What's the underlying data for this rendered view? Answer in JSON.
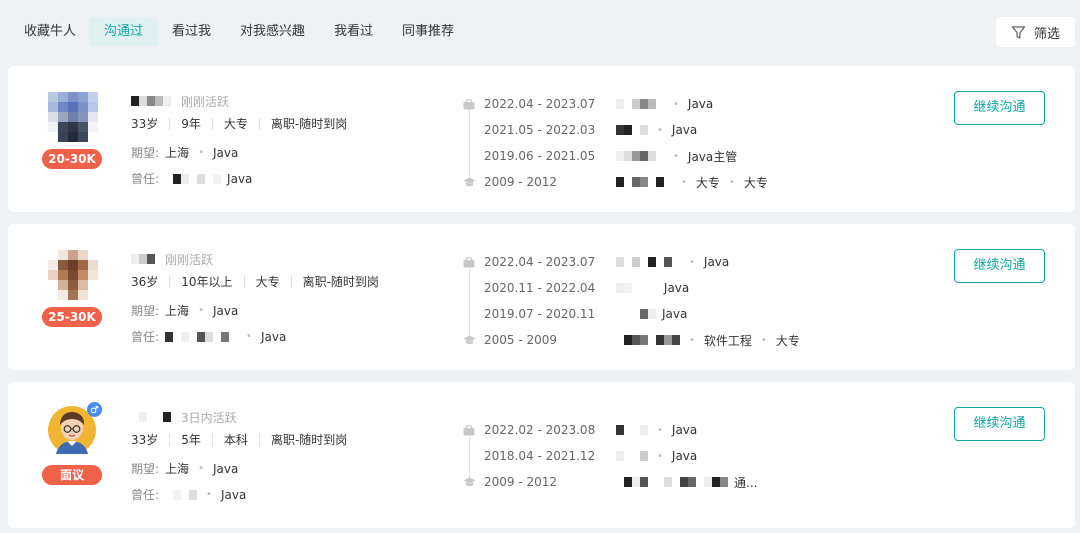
{
  "tabs": [
    {
      "label": "收藏牛人",
      "active": false
    },
    {
      "label": "沟通过",
      "active": true
    },
    {
      "label": "看过我",
      "active": false
    },
    {
      "label": "对我感兴趣",
      "active": false
    },
    {
      "label": "我看过",
      "active": false
    },
    {
      "label": "同事推荐",
      "active": false
    }
  ],
  "filter": {
    "label": "筛选",
    "icon": "filter-icon"
  },
  "colors": {
    "accent": "#12a4a6",
    "badge": "#f0614a",
    "background": "#eef2f5"
  },
  "candidates": [
    {
      "status": "刚刚活跃",
      "age": "33岁",
      "experience": "9年",
      "education": "大专",
      "job_status": "离职-随时到岗",
      "salary": "20-30K",
      "expect_label": "期望:",
      "expect_city": "上海",
      "expect_job": "Java",
      "former_label": "曾任:",
      "former_job": "Java",
      "history": [
        {
          "date": "2022.04 - 2023.07",
          "role": "Java",
          "type": "work"
        },
        {
          "date": "2021.05 - 2022.03",
          "role": "Java",
          "type": "work"
        },
        {
          "date": "2019.06 - 2021.05",
          "role": "Java主管",
          "type": "work"
        },
        {
          "date": "2009 - 2012",
          "role": "大专",
          "extra": "大专",
          "type": "edu"
        }
      ],
      "action": "继续沟通"
    },
    {
      "status": "刚刚活跃",
      "age": "36岁",
      "experience": "10年以上",
      "education": "大专",
      "job_status": "离职-随时到岗",
      "salary": "25-30K",
      "expect_label": "期望:",
      "expect_city": "上海",
      "expect_job": "Java",
      "former_label": "曾任:",
      "former_job": "Java",
      "history": [
        {
          "date": "2022.04 - 2023.07",
          "role": "Java",
          "type": "work"
        },
        {
          "date": "2020.11 - 2022.04",
          "role": "Java",
          "type": "work"
        },
        {
          "date": "2019.07 - 2020.11",
          "role": "Java",
          "type": "work"
        },
        {
          "date": "2005 - 2009",
          "role": "软件工程",
          "extra": "大专",
          "type": "edu"
        }
      ],
      "action": "继续沟通"
    },
    {
      "status": "3日内活跃",
      "age": "33岁",
      "experience": "5年",
      "education": "本科",
      "job_status": "离职-随时到岗",
      "salary": "面议",
      "expect_label": "期望:",
      "expect_city": "上海",
      "expect_job": "Java",
      "former_label": "曾任:",
      "former_job": "Java",
      "history": [
        {
          "date": "2022.02 - 2023.08",
          "role": "Java",
          "type": "work"
        },
        {
          "date": "2018.04 - 2021.12",
          "role": "Java",
          "type": "work"
        },
        {
          "date": "2009 - 2012",
          "role": "通...",
          "type": "edu"
        }
      ],
      "action": "继续沟通"
    }
  ]
}
